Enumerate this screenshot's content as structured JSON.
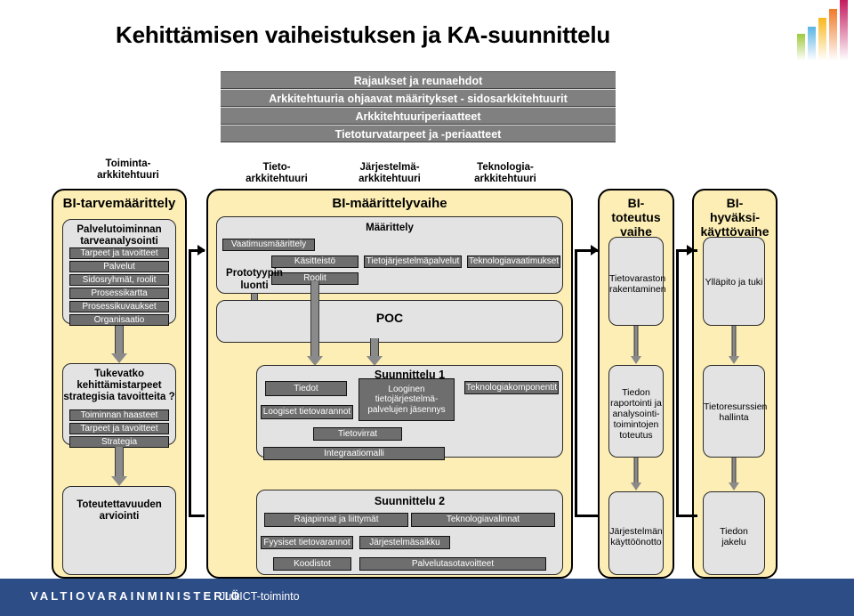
{
  "title": "Kehittämisen vaiheistuksen ja KA-suunnittelu",
  "constraints": [
    "Rajaukset ja reunaehdot",
    "Arkkitehtuuria ohjaavat määritykset - sidosarkkitehtuurit",
    "Arkkitehtuuriperiaatteet",
    "Tietoturvatarpeet ja -periaatteet"
  ],
  "column_captions": [
    "Toiminta-\narkkitehtuuri",
    "Tieto-\narkkitehtuuri",
    "Järjestelmä-\narkkitehtuuri",
    "Teknologia-\narkkitehtuuri"
  ],
  "column_captions_flat": {
    "toiminta_1": "Toiminta-",
    "toiminta_2": "arkkitehtuuri",
    "tieto_1": "Tieto-",
    "tieto_2": "arkkitehtuuri",
    "jarjestelma_1": "Järjestelmä-",
    "jarjestelma_2": "arkkitehtuuri",
    "teknologia_1": "Teknologia-",
    "teknologia_2": "arkkitehtuuri"
  },
  "lanes": {
    "tarvemaarittely": "BI-tarvemäärittely",
    "maarittelyvaihe": "BI-määrittelyvaihe",
    "toteutus_1": "BI-",
    "toteutus_2": "toteutus",
    "toteutus_3": "vaihe",
    "hyvaksi_1": "BI-",
    "hyvaksi_2": "hyväksi-",
    "hyvaksi_3": "käyttövaihe"
  },
  "row1": {
    "left_box_title_1": "Palvelutoiminnan",
    "left_box_title_2": "tarveanalysointi",
    "left_items": [
      "Tarpeet ja tavoitteet",
      "Palvelut",
      "Sidosryhmät, roolit",
      "Prosessikartta",
      "Prosessikuvaukset",
      "Organisaatio"
    ],
    "maarittely_title": "Määrittely",
    "vaatimusmaarittely": "Vaatimusmäärittely",
    "kasitteisto": "Käsitteistö",
    "roolit": "Roolit",
    "tietojarjestelmapalvelut": "Tietojärjestelmäpalvelut",
    "teknologiavaatimukset": "Teknologiavaatimukset",
    "prototyypin_1": "Prototyypin",
    "prototyypin_2": "luonti",
    "poc": "POC",
    "tietovaraston_1": "Tietovaraston",
    "tietovaraston_2": "rakentaminen",
    "yllapito": "Ylläpito ja tuki"
  },
  "row2": {
    "left_box_title_1": "Tukevatko",
    "left_box_title_2": "kehittämistarpeet",
    "left_box_title_3": "strategisia tavoitteita ?",
    "left_items": [
      "Toiminnan haasteet",
      "Tarpeet ja tavoitteet",
      "Strategia"
    ],
    "title": "Suunnittelu 1",
    "tiedot": "Tiedot",
    "loogiset_tietovarannot": "Loogiset tietovarannot",
    "looginen_1": "Looginen",
    "looginen_2": "tietojärjestelmä-",
    "looginen_3": "palvelujen jäsennys",
    "teknologiakomponentit": "Teknologiakomponentit",
    "tietovirrat": "Tietovirrat",
    "integraatiomalli": "Integraatiomalli",
    "tiedon_rap_1": "Tiedon",
    "tiedon_rap_2": "raportointi ja",
    "tiedon_rap_3": "analysointi-",
    "tiedon_rap_4": "toimintojen",
    "tiedon_rap_5": "toteutus",
    "tietoresurssien_1": "Tietoresurssien",
    "tietoresurssien_2": "hallinta"
  },
  "row3": {
    "left_box_title_1": "Toteutettavuuden",
    "left_box_title_2": "arviointi",
    "title": "Suunnittelu 2",
    "rajapinnat": "Rajapinnat ja liittymät",
    "teknologiavalinnat": "Teknologiavalinnat",
    "fyysiset_tietovarannot": "Fyysiset tietovarannot",
    "jarjestelmasalkku": "Järjestelmäsalkku",
    "koodistot": "Koodistot",
    "palvelutasotavoitteet": "Palvelutasotavoitteet",
    "jarjestelman_1": "Järjestelmän",
    "jarjestelman_2": "käyttöönotto",
    "tiedon_jakelu_1": "Tiedon",
    "tiedon_jakelu_2": "jakelu"
  },
  "footer": {
    "ministry": "VALTIOVARAINMINISTERIÖ",
    "unit": "JulkICT-toiminto"
  },
  "colors": {
    "lane_fill": "#fdeeb5",
    "group_fill": "#e3e3e3",
    "item_fill": "#6e6e6e",
    "band_fill": "#808080",
    "footer_bg": "#2d4d86"
  }
}
